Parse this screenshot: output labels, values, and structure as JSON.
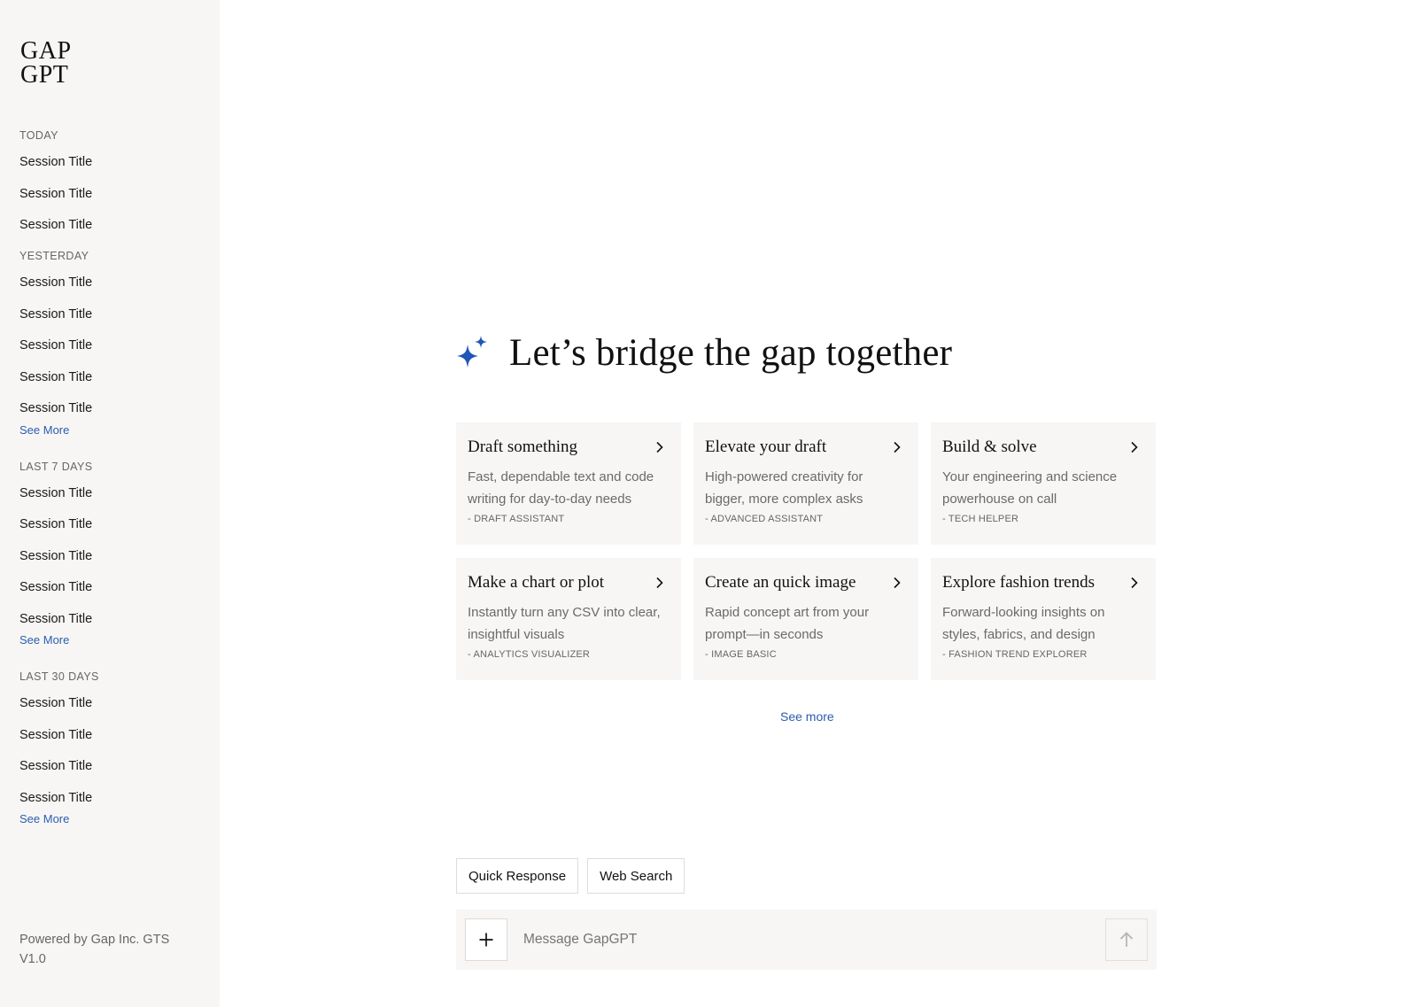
{
  "app": {
    "logo_line1": "GAP",
    "logo_line2": "GPT",
    "footer_line1": "Powered by Gap Inc. GTS",
    "footer_line2": "V1.0"
  },
  "sidebar": {
    "groups": [
      {
        "label": "TODAY",
        "sessions": [
          "Session Title",
          "Session Title",
          "Session Title"
        ],
        "see_more": ""
      },
      {
        "label": "YESTERDAY",
        "sessions": [
          "Session Title",
          "Session Title",
          "Session Title",
          "Session Title",
          "Session Title"
        ],
        "see_more": "See More"
      },
      {
        "label": "LAST 7 DAYS",
        "sessions": [
          "Session Title",
          "Session Title",
          "Session Title",
          "Session Title",
          "Session Title"
        ],
        "see_more": "See More"
      },
      {
        "label": "LAST 30 DAYS",
        "sessions": [
          "Session Title",
          "Session Title",
          "Session Title",
          "Session Title"
        ],
        "see_more": "See More"
      }
    ]
  },
  "main": {
    "hero_title": "Let’s bridge the gap together",
    "accent_color": "#2a5db0",
    "cards": [
      {
        "title": "Draft something",
        "desc": "Fast, dependable text and code writing for day-to-day needs",
        "tag": "- DRAFT ASSISTANT"
      },
      {
        "title": "Elevate your draft",
        "desc": "High-powered creativity for bigger, more complex asks",
        "tag": "- ADVANCED ASSISTANT"
      },
      {
        "title": "Build & solve",
        "desc": "Your engineering and science powerhouse on call",
        "tag": "- TECH HELPER"
      },
      {
        "title": "Make a chart or plot",
        "desc": "Instantly turn any CSV into clear, insightful visuals",
        "tag": "- ANALYTICS VISUALIZER"
      },
      {
        "title": "Create an quick image",
        "desc": "Rapid concept art from your prompt—in seconds",
        "tag": "- IMAGE BASIC"
      },
      {
        "title": "Explore fashion trends",
        "desc": "Forward-looking insights on styles, fabrics, and design",
        "tag": "- FASHION TREND EXPLORER"
      }
    ],
    "see_more": "See more",
    "chips": [
      "Quick Response",
      "Web Search"
    ],
    "composer": {
      "placeholder": "Message GapGPT",
      "value": ""
    }
  }
}
